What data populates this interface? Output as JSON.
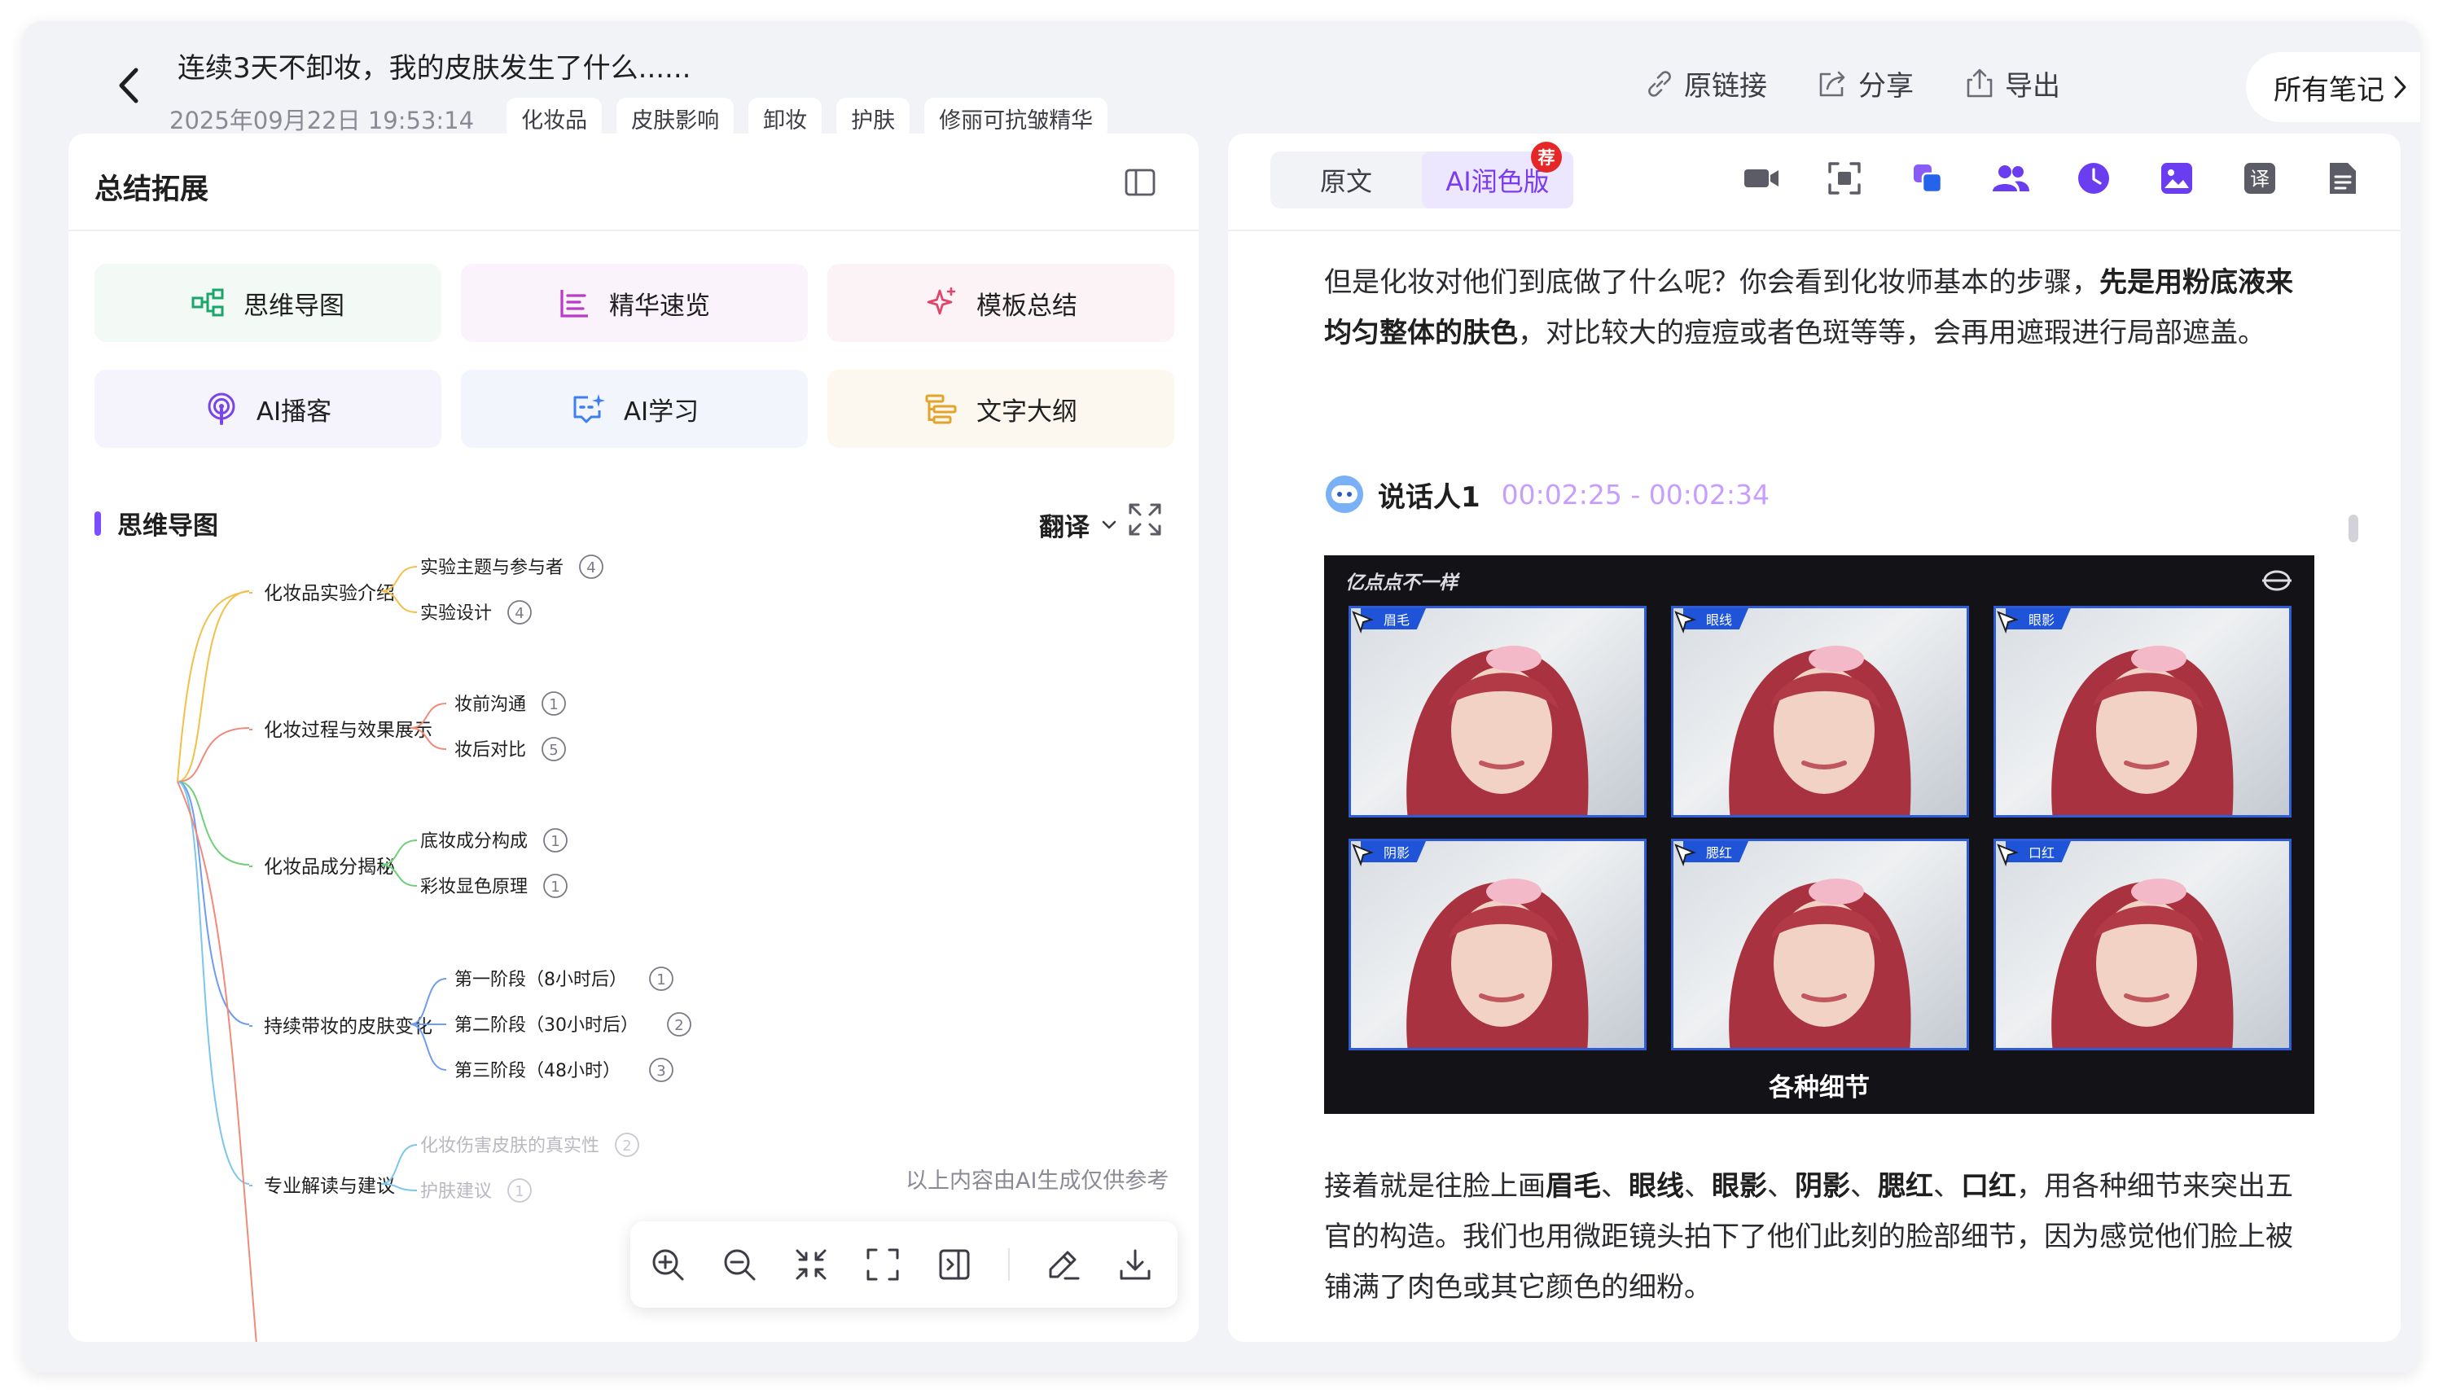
{
  "header": {
    "title": "连续3天不卸妆，我的皮肤发生了什么......",
    "date": "2025年09月22日 19:53:14",
    "tags": [
      "化妆品",
      "皮肤影响",
      "卸妆",
      "护肤",
      "修丽可抗皱精华"
    ],
    "actions": [
      {
        "label": "原链接",
        "icon": "link-icon"
      },
      {
        "label": "分享",
        "icon": "share-icon"
      },
      {
        "label": "导出",
        "icon": "export-icon"
      }
    ],
    "all_notes": "所有笔记"
  },
  "left_panel": {
    "title": "总结拓展",
    "features": [
      {
        "label": "思维导图",
        "icon": "mindmap-icon",
        "color": "#1aa66b"
      },
      {
        "label": "精华速览",
        "icon": "list-icon",
        "color": "#b83cc4"
      },
      {
        "label": "模板总结",
        "icon": "sparkle-icon",
        "color": "#e0466c"
      },
      {
        "label": "AI播客",
        "icon": "podcast-icon",
        "color": "#7b45e6"
      },
      {
        "label": "AI学习",
        "icon": "ai-chat-icon",
        "color": "#3f7df0"
      },
      {
        "label": "文字大纲",
        "icon": "outline-icon",
        "color": "#e2a42a"
      }
    ],
    "mindmap": {
      "heading": "思维导图",
      "translate_label": "翻译",
      "branches": [
        {
          "label": "化妆品实验介绍",
          "color": "#f2c04a",
          "children": [
            {
              "label": "实验主题与参与者",
              "count": "4"
            },
            {
              "label": "实验设计",
              "count": "4"
            }
          ]
        },
        {
          "label": "化妆过程与效果展示",
          "color": "#f08a7a",
          "children": [
            {
              "label": "妆前沟通",
              "count": "1"
            },
            {
              "label": "妆后对比",
              "count": "5"
            }
          ]
        },
        {
          "label": "化妆品成分揭秘",
          "color": "#6fd07a",
          "children": [
            {
              "label": "底妆成分构成",
              "count": "1"
            },
            {
              "label": "彩妆显色原理",
              "count": "1"
            }
          ]
        },
        {
          "label": "持续带妆的皮肤变化",
          "color": "#6e9cf0",
          "children": [
            {
              "label": "第一阶段（8小时后）",
              "count": "1"
            },
            {
              "label": "第二阶段（30小时后）",
              "count": "2"
            },
            {
              "label": "第三阶段（48小时）",
              "count": "3"
            }
          ]
        },
        {
          "label": "专业解读与建议",
          "color": "#7cc6ee",
          "children": [
            {
              "label": "化妆伤害皮肤的真实性",
              "count": "2"
            },
            {
              "label": "护肤建议",
              "count": "1"
            }
          ]
        }
      ],
      "note": "以上内容由AI生成仅供参考"
    }
  },
  "right_panel": {
    "tabs": [
      {
        "label": "原文"
      },
      {
        "label": "AI润色版"
      }
    ],
    "badge": "荐",
    "para1": {
      "pre": "但是化妆对他们到底做了什么呢？你会看到化妆师基本的步骤，",
      "bold": "先是用粉底液来均匀整体的肤色",
      "post": "，对比较大的痘痘或者色斑等等，会再用遮瑕进行局部遮盖。"
    },
    "speaker": {
      "name": "说话人1",
      "time": "00:02:25 - 00:02:34"
    },
    "video": {
      "top_text": "亿点点不一样",
      "tiles": [
        "眉毛",
        "眼线",
        "眼影",
        "阴影",
        "腮红",
        "口红"
      ],
      "caption": "各种细节"
    },
    "para2": {
      "s1": "接着就是往脸上画",
      "b1": "眉毛",
      "c1": "、",
      "b2": "眼线",
      "c2": "、",
      "b3": "眼影",
      "c3": "、",
      "b4": "阴影",
      "c4": "、",
      "b5": "腮红",
      "c5": "、",
      "b6": "口红",
      "s2": "，用各种细节来突出五官的构造。我们也用微距镜头拍下了他们此刻的脸部细节，因为感觉他们脸上被铺满了肉色或其它颜色的细粉。"
    }
  }
}
